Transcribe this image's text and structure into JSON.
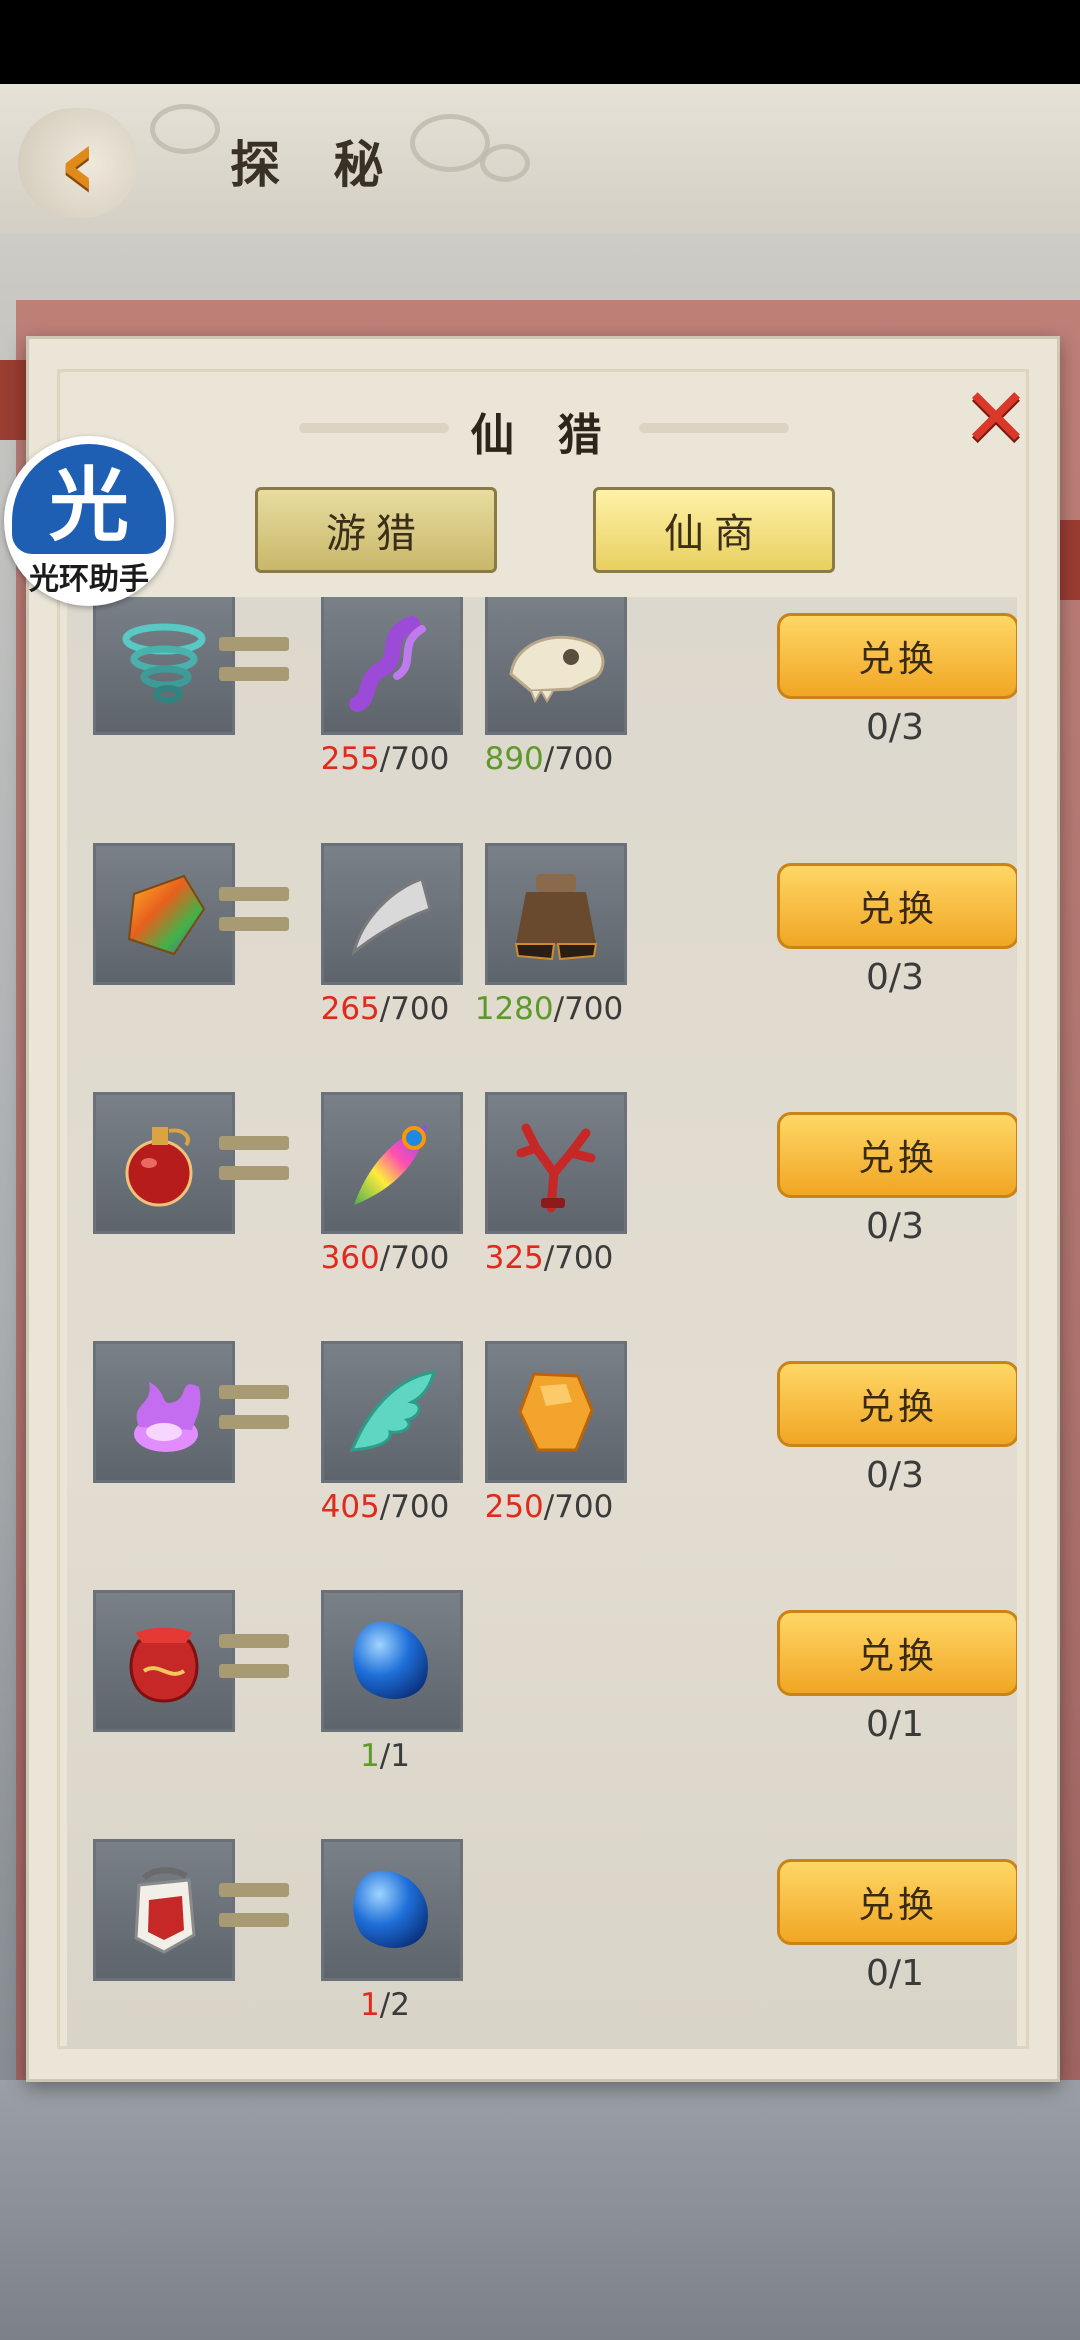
{
  "header": {
    "title": "探 秘"
  },
  "dialog": {
    "title": "仙 猎",
    "tabs": [
      {
        "label": "游猎",
        "active": false
      },
      {
        "label": "仙商",
        "active": true
      }
    ]
  },
  "watermark": {
    "glyph": "光",
    "text": "光环助手"
  },
  "exchange_rows": [
    {
      "result_icon": "whirlwind-icon",
      "costs": [
        {
          "icon": "purple-hair-icon",
          "have": "255",
          "need": "/700",
          "have_color": "red"
        },
        {
          "icon": "beast-skull-icon",
          "have": "890",
          "need": "/700",
          "have_color": "green"
        }
      ],
      "button": "兑换",
      "limit": "0/3"
    },
    {
      "result_icon": "rainbow-gem-icon",
      "costs": [
        {
          "icon": "fang-icon",
          "have": "265",
          "need": "/700",
          "have_color": "red"
        },
        {
          "icon": "hoof-icon",
          "have": "1280",
          "need": "/700",
          "have_color": "green"
        }
      ],
      "button": "兑换",
      "limit": "0/3"
    },
    {
      "result_icon": "red-potion-icon",
      "costs": [
        {
          "icon": "peacock-feather-icon",
          "have": "360",
          "need": "/700",
          "have_color": "red"
        },
        {
          "icon": "red-coral-icon",
          "have": "325",
          "need": "/700",
          "have_color": "red"
        }
      ],
      "button": "兑换",
      "limit": "0/3"
    },
    {
      "result_icon": "purple-flame-icon",
      "costs": [
        {
          "icon": "jade-wing-icon",
          "have": "405",
          "need": "/700",
          "have_color": "red"
        },
        {
          "icon": "amber-stone-icon",
          "have": "250",
          "need": "/700",
          "have_color": "red"
        }
      ],
      "button": "兑换",
      "limit": "0/3"
    },
    {
      "result_icon": "red-pouch-icon",
      "costs": [
        {
          "icon": "blue-gem-icon",
          "have": "1",
          "need": "/1",
          "have_color": "green"
        }
      ],
      "button": "兑换",
      "limit": "0/1"
    },
    {
      "result_icon": "badge-scroll-icon",
      "costs": [
        {
          "icon": "blue-gem-icon",
          "have": "1",
          "need": "/2",
          "have_color": "red"
        }
      ],
      "button": "兑换",
      "limit": "0/1"
    }
  ]
}
